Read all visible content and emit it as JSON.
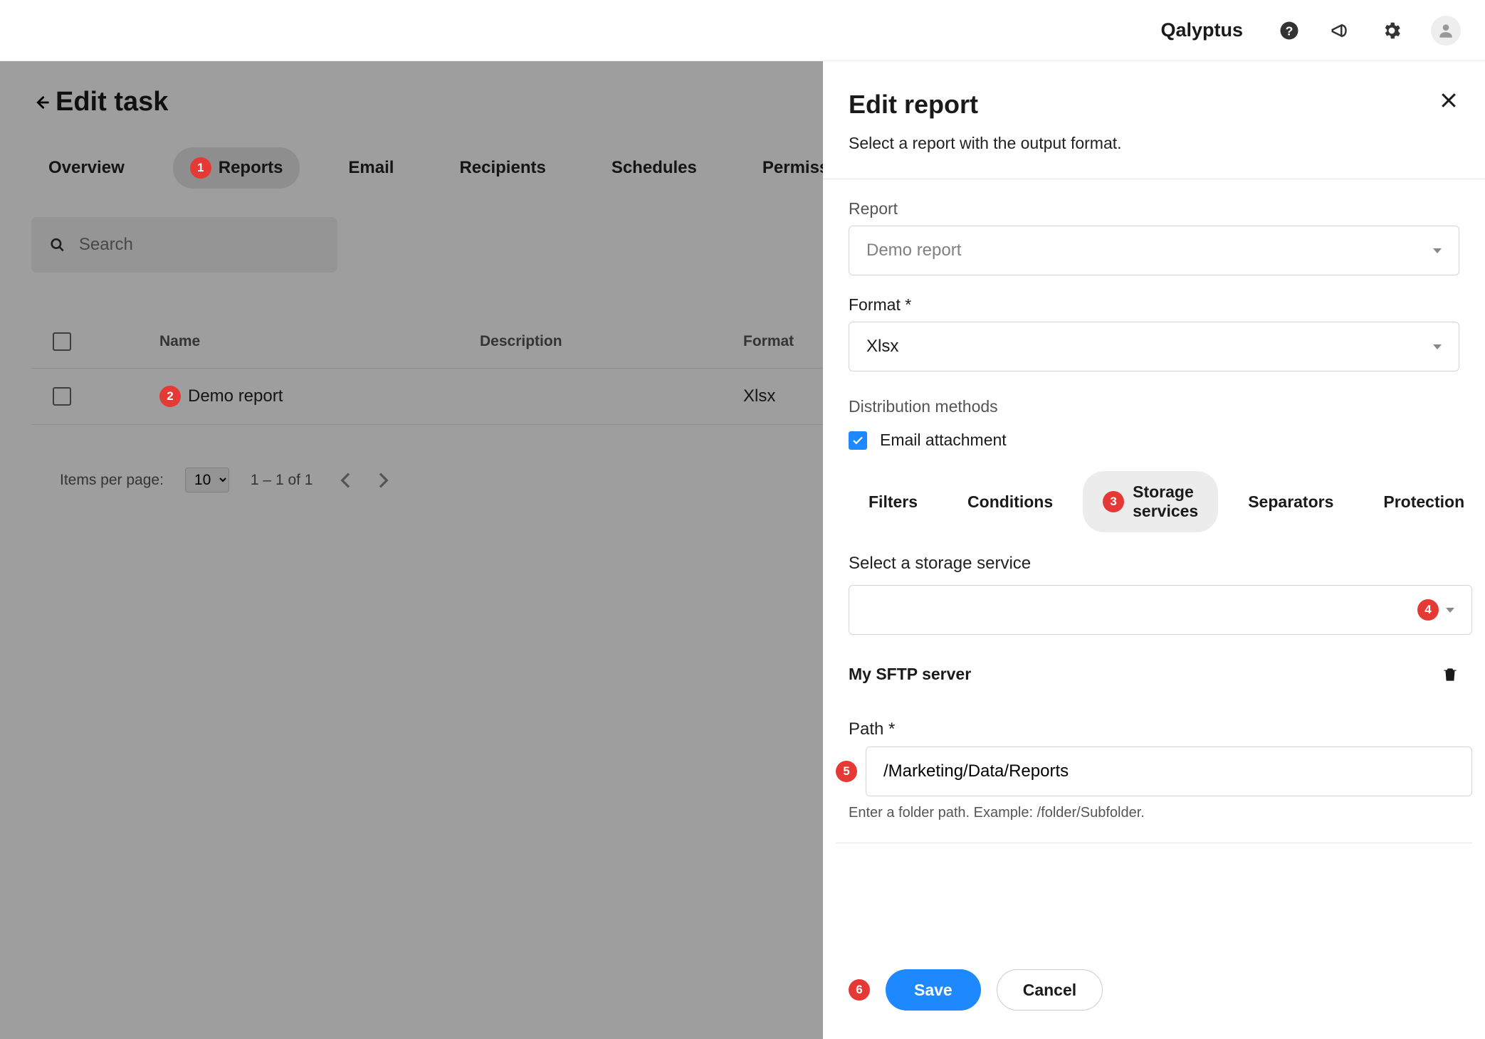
{
  "brand": "Qalyptus",
  "page": {
    "title": "Edit task",
    "tabs": [
      "Overview",
      "Reports",
      "Email",
      "Recipients",
      "Schedules",
      "Permissions"
    ],
    "active_tab": "Reports"
  },
  "search": {
    "placeholder": "Search"
  },
  "table": {
    "headers": {
      "name": "Name",
      "description": "Description",
      "format": "Format"
    },
    "rows": [
      {
        "name": "Demo report",
        "description": "",
        "format": "Xlsx"
      }
    ]
  },
  "pager": {
    "label": "Items per page:",
    "size": "10",
    "range": "1 – 1 of 1"
  },
  "drawer": {
    "title": "Edit report",
    "subtitle": "Select a report with the output format.",
    "report_label": "Report",
    "report_value": "Demo report",
    "format_label": "Format *",
    "format_value": "Xlsx",
    "dist_label": "Distribution methods",
    "email_attach": "Email attachment",
    "subtabs": [
      "Filters",
      "Conditions",
      "Storage services",
      "Separators",
      "Protection"
    ],
    "active_subtab": "Storage services",
    "storage": {
      "select_label": "Select a storage service",
      "server_name": "My SFTP server",
      "path_label": "Path *",
      "path_value": "/Marketing/Data/Reports",
      "path_hint": "Enter a folder path. Example: /folder/Subfolder."
    },
    "buttons": {
      "save": "Save",
      "cancel": "Cancel"
    }
  },
  "callouts": {
    "c1": "1",
    "c2": "2",
    "c3": "3",
    "c4": "4",
    "c5": "5",
    "c6": "6"
  }
}
